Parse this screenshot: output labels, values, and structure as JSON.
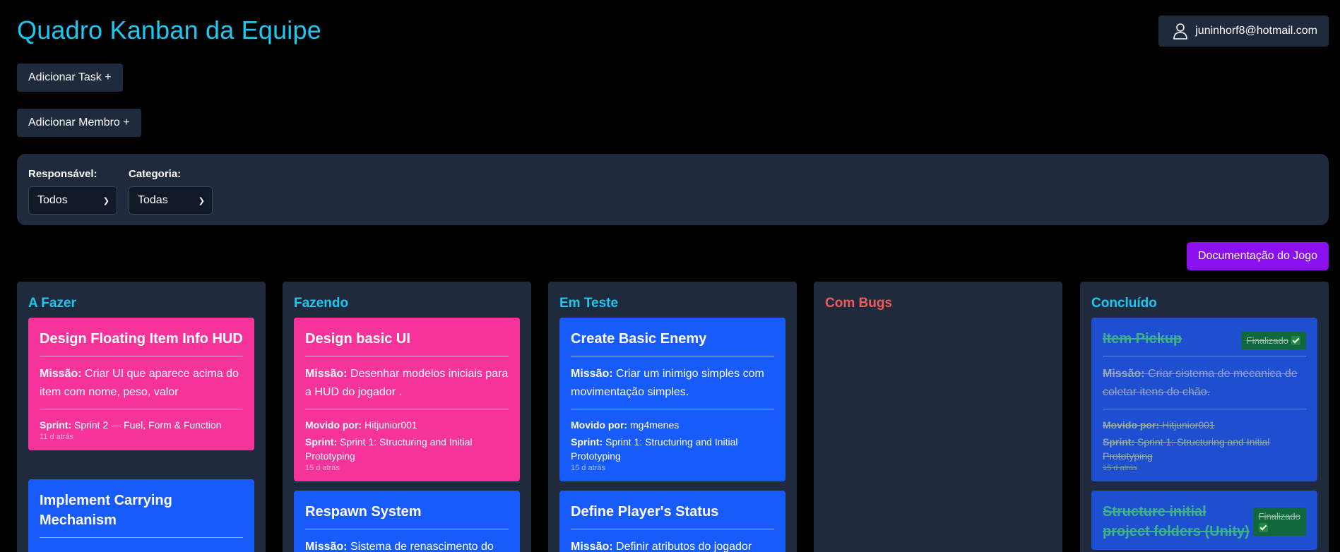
{
  "header": {
    "title": "Quadro Kanban da Equipe",
    "user_email": "juninhorf8@hotmail.com",
    "user_icon": "user-icon"
  },
  "actions": {
    "add_task": "Adicionar Task +",
    "add_member": "Adicionar Membro +",
    "documentation": "Documentação do Jogo"
  },
  "filters": {
    "responsavel_label": "Responsável:",
    "responsavel_value": "Todos",
    "categoria_label": "Categoria:",
    "categoria_value": "Todas"
  },
  "colors": {
    "accent": "#1cc8ef",
    "bugs": "#f05a5a",
    "panel": "#1f2a3c",
    "card_pink": "#f5339b",
    "card_blue": "#175cfb",
    "doc_button": "#8a10f0"
  },
  "columns": [
    {
      "title": "A Fazer",
      "cards": [
        {
          "title": "Design Floating Item Info HUD",
          "mission_label": "Missão:",
          "mission": "Criar UI que aparece acima do item com nome, peso, valor",
          "sprint_label": "Sprint:",
          "sprint": "Sprint 2 — Fuel, Form & Function",
          "time": "11 d atrás"
        },
        {
          "title": "Implement Carrying Mechanism"
        }
      ]
    },
    {
      "title": "Fazendo",
      "cards": [
        {
          "title": "Design basic UI",
          "mission_label": "Missão:",
          "mission": "Desenhar modelos iniciais para a HUD do jogador .",
          "moved_label": "Movido por:",
          "moved_by": "Hitjunior001",
          "sprint_label": "Sprint:",
          "sprint": "Sprint 1: Structuring and Initial Prototyping",
          "time": "15 d atrás"
        },
        {
          "title": "Respawn System",
          "mission_label": "Missão:",
          "mission": "Sistema de renascimento do"
        }
      ]
    },
    {
      "title": "Em Teste",
      "cards": [
        {
          "title": "Create Basic Enemy",
          "mission_label": "Missão:",
          "mission": "Criar um inimigo simples com movimentação simples.",
          "moved_label": "Movido por:",
          "moved_by": "mg4menes",
          "sprint_label": "Sprint:",
          "sprint": "Sprint 1: Structuring and Initial Prototyping",
          "time": "15 d atrás"
        },
        {
          "title": "Define Player's Status",
          "mission_label": "Missão:",
          "mission": "Definir atributos do jogador"
        }
      ]
    },
    {
      "title": "Com Bugs",
      "cards": []
    },
    {
      "title": "Concluído",
      "cards": [
        {
          "title": "Item Pickup",
          "badge": "Finalizado",
          "mission_label": "Missão:",
          "mission": "Criar sistema de mecanica de coletar itens do chão.",
          "moved_label": "Movido por:",
          "moved_by": "Hitjunior001",
          "sprint_label": "Sprint:",
          "sprint": "Sprint 1: Structuring and Initial Prototyping",
          "time": "15 d atrás"
        },
        {
          "title": "Structure initial project folders (Unity)",
          "badge": "Finalizado"
        }
      ]
    }
  ]
}
